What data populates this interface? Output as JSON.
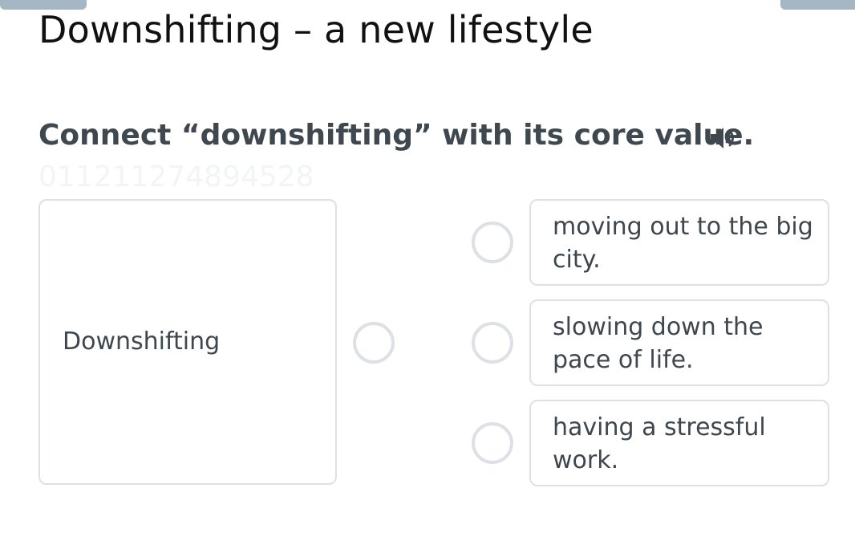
{
  "header": {
    "title": "Downshifting – a new lifestyle"
  },
  "question": {
    "instruction": "Connect “downshifting” with its core value.",
    "speaker_icon": "speaker-icon",
    "watermark": "011211274894528"
  },
  "left_item": {
    "label": "Downshifting"
  },
  "options": [
    {
      "text": "moving out to the big city."
    },
    {
      "text": "slowing down the pace of life."
    },
    {
      "text": "having a stressful work."
    }
  ],
  "colors": {
    "title": "#111111",
    "instruction": "#3f474f",
    "card_border": "#dde1e5",
    "body_text": "#3e464e",
    "top_tab": "#a4b7c2"
  }
}
